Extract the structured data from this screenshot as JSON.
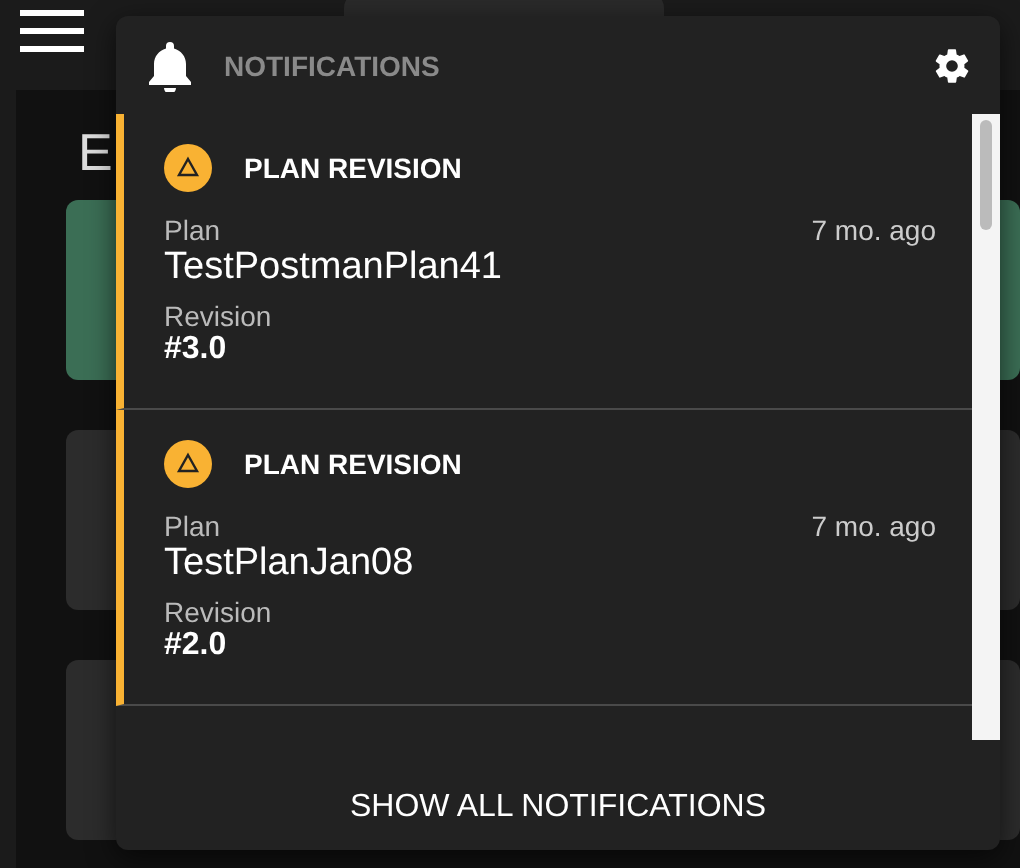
{
  "page": {
    "title_fragment": "E"
  },
  "notifications": {
    "title": "NOTIFICATIONS",
    "items": [
      {
        "kind": "warning",
        "category": "PLAN REVISION",
        "time": "7 mo. ago",
        "fields": [
          {
            "label": "Plan",
            "value": "TestPostmanPlan41"
          },
          {
            "label": "Revision",
            "value": "#3.0"
          }
        ]
      },
      {
        "kind": "warning",
        "category": "PLAN REVISION",
        "time": "7 mo. ago",
        "fields": [
          {
            "label": "Plan",
            "value": "TestPlanJan08"
          },
          {
            "label": "Revision",
            "value": "#2.0"
          }
        ]
      }
    ],
    "footer_button": "SHOW ALL NOTIFICATIONS"
  }
}
